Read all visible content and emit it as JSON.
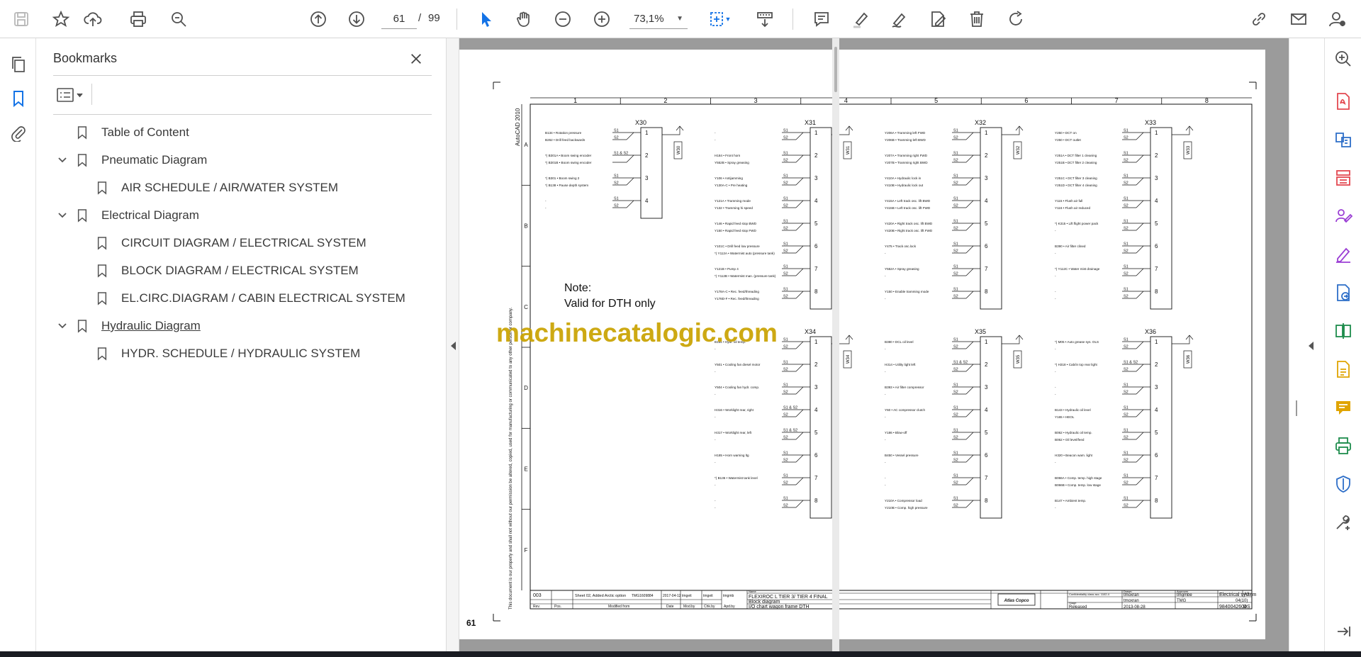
{
  "toolbar": {
    "page_current": "61",
    "page_separator": "/",
    "page_total": "99",
    "zoom_value": "73,1%"
  },
  "bookmarks": {
    "title": "Bookmarks",
    "items": [
      {
        "label": "Table of Content"
      },
      {
        "label": "Pneumatic Diagram"
      },
      {
        "label": "AIR SCHEDULE / AIR/WATER SYSTEM"
      },
      {
        "label": "Electrical Diagram"
      },
      {
        "label": "CIRCUIT DIAGRAM / ELECTRICAL SYSTEM"
      },
      {
        "label": "BLOCK DIAGRAM / ELECTRICAL SYSTEM"
      },
      {
        "label": "EL.CIRC.DIAGRAM / CABIN ELECTRICAL SYSTEM"
      },
      {
        "label": "Hydraulic Diagram"
      },
      {
        "label": "HYDR. SCHEDULE / HYDRAULIC SYSTEM"
      }
    ]
  },
  "document": {
    "page_label": "61",
    "watermark": "machinecatalogic.com",
    "cad_label": "AutoCAD 2010",
    "note_line1": "Note:",
    "note_line2": "Valid for DTH only",
    "col_numbers": [
      "1",
      "2",
      "3",
      "4",
      "5",
      "6",
      "7",
      "8"
    ],
    "row_letters": [
      "A",
      "B",
      "C",
      "D",
      "E",
      "F"
    ],
    "connectors": [
      {
        "name": "X30",
        "pins": [
          "1",
          "2",
          "3",
          "4"
        ],
        "side": "W30",
        "lines": [
          [
            "B134 • Rotation pressure",
            "S1"
          ],
          [
            "B262 • Drill feed backwards",
            "S2"
          ],
          [
            "*) B301A • Boom swing encoder",
            "S1 & S2"
          ],
          [
            "*) B301B • Boom swing encoder",
            ""
          ],
          [
            "*) B301 • Boom swing 2",
            "S1"
          ],
          [
            "*) B138 • Pause depth system",
            "S2"
          ],
          [
            "-",
            "S1"
          ],
          [
            "-",
            "S2"
          ]
        ]
      },
      {
        "name": "X31",
        "pins": [
          "1",
          "2",
          "3",
          "4",
          "5",
          "6",
          "7",
          "8"
        ],
        "side": "W31",
        "lines": [
          [
            "-",
            "S1"
          ],
          [
            "-",
            "S2"
          ],
          [
            "H184 • Front horn",
            "S1"
          ],
          [
            "Y552B • Spray greasing",
            "S2"
          ],
          [
            "Y106 • Antijamming",
            "S1"
          ],
          [
            "Y130A-C • Pre heating",
            "S2"
          ],
          [
            "Y121A • Tramming mode",
            "S1"
          ],
          [
            "Y132 • Tramming hi speed",
            "S2"
          ],
          [
            "Y146 • Rapid feed stop BWD",
            "S1"
          ],
          [
            "Y150 • Rapid feed stop FWD",
            "S2"
          ],
          [
            "Y101C • Drill feed low pressure",
            "S1"
          ],
          [
            "*) Y112A • Watermist auto (pressure tank)",
            "S2"
          ],
          [
            "Y121B • Pump 4",
            "S1"
          ],
          [
            "*) Y112B • Watermist man. (pressure tank)",
            "S2"
          ],
          [
            "Y178A-C • Rec. feed/threading",
            "S1"
          ],
          [
            "Y178D-F • Rec. feed/threading",
            "S2"
          ]
        ]
      },
      {
        "name": "X32",
        "pins": [
          "1",
          "2",
          "3",
          "4",
          "5",
          "6",
          "7",
          "8"
        ],
        "side": "W32",
        "lines": [
          [
            "Y206A • Tramming left FWD",
            "S1"
          ],
          [
            "Y206B • Tramming left BWD",
            "S2"
          ],
          [
            "Y207A • Tramming right FWD",
            "S1"
          ],
          [
            "Y207B • Tramming right BWD",
            "S2"
          ],
          [
            "Y410A • Hydraulic lock in",
            "S1"
          ],
          [
            "Y410B • Hydraulic lock out",
            "S2"
          ],
          [
            "Y415A • Left track osc. lift BWD",
            "S1"
          ],
          [
            "Y415B • Left track osc. lift FWD",
            "S2"
          ],
          [
            "Y420A • Right track osc. lift BWD",
            "S1"
          ],
          [
            "Y420B • Right track osc. lift FWD",
            "S2"
          ],
          [
            "Y475 • Track osc.lock",
            "S1"
          ],
          [
            "-",
            "S2"
          ],
          [
            "Y552A • Spray greasing",
            "S1"
          ],
          [
            "-",
            "S2"
          ],
          [
            "Y150 • Enable tramming mode",
            "S1"
          ],
          [
            "-",
            "S2"
          ]
        ]
      },
      {
        "name": "X33",
        "pins": [
          "1",
          "2",
          "3",
          "4",
          "5",
          "6",
          "7",
          "8"
        ],
        "side": "W33",
        "lines": [
          [
            "Y250 • DCT on",
            "S1"
          ],
          [
            "Y250 • DCT outlet",
            "S2"
          ],
          [
            "Y251A • DCT filter 1 cleaning",
            "S1"
          ],
          [
            "Y251B • DCT filter 2 cleaning",
            "S2"
          ],
          [
            "Y251C • DCT filter 3 cleaning",
            "S1"
          ],
          [
            "Y251D • DCT filter 4 cleaning",
            "S2"
          ],
          [
            "Y115 • Flush air full",
            "S1"
          ],
          [
            "Y116 • Flush air reduced",
            "S2"
          ],
          [
            "*) K315 • Lift flight power pack",
            "S1"
          ],
          [
            "-",
            "S2"
          ],
          [
            "B390 • Air filter clined",
            "S1"
          ],
          [
            "-",
            "S2"
          ],
          [
            "*) Y112C • Water mist drainage",
            "S1"
          ],
          [
            "-",
            "S2"
          ],
          [
            "-",
            "S1"
          ],
          [
            "-",
            "S2"
          ]
        ]
      },
      {
        "name": "X34",
        "pins": [
          "1",
          "2",
          "3",
          "4",
          "5",
          "6",
          "7",
          "8"
        ],
        "side": "W34",
        "lines": [
          [
            "B184 • Hydr. oil temp.",
            "S1"
          ],
          [
            "-",
            "S2"
          ],
          [
            "Y501 • Cooling fan diesel motor",
            "S1"
          ],
          [
            "-",
            "S2"
          ],
          [
            "Y504 • Cooling fan hydr. comp.",
            "S1"
          ],
          [
            "-",
            "S2"
          ],
          [
            "H316 • Worklight rear, right",
            "S1 & S2"
          ],
          [
            "-",
            "S2"
          ],
          [
            "H317 • Worklight rear, left",
            "S1 & S2"
          ],
          [
            "-",
            "S2"
          ],
          [
            "H185 • Horn warning ltg",
            "S1"
          ],
          [
            "-",
            "S2"
          ],
          [
            "*) B136 • Watermist tank level",
            "S1"
          ],
          [
            "-",
            "S2"
          ],
          [
            "-",
            "S1"
          ],
          [
            "-",
            "S2"
          ]
        ]
      },
      {
        "name": "X35",
        "pins": [
          "1",
          "2",
          "3",
          "4",
          "5",
          "6",
          "7",
          "8"
        ],
        "side": "W35",
        "lines": [
          [
            "B380 • DCL oil level",
            "S1"
          ],
          [
            "-",
            "S2"
          ],
          [
            "H314 • Utility light left",
            "S1 & S2"
          ],
          [
            "-",
            "S2"
          ],
          [
            "B393 • Air filter compressor",
            "S1"
          ],
          [
            "-",
            "S2"
          ],
          [
            "Y60 • AC compressor clutch",
            "S1"
          ],
          [
            "-",
            "S2"
          ],
          [
            "Y186 • Blow-off",
            "S1"
          ],
          [
            "-",
            "S2"
          ],
          [
            "B450 • Vessel pressure",
            "S1"
          ],
          [
            "-",
            "S2"
          ],
          [
            "-",
            "S1"
          ],
          [
            "-",
            "S2"
          ],
          [
            "Y210A • Compressor load",
            "S1"
          ],
          [
            "Y210B • Comp. high pressure",
            "S2"
          ]
        ]
      },
      {
        "name": "X36",
        "pins": [
          "1",
          "2",
          "3",
          "4",
          "5",
          "6",
          "7",
          "8"
        ],
        "side": "W36",
        "lines": [
          [
            "*) M05 • Auto grease sys. OLS",
            "S1"
          ],
          [
            "-",
            "S2"
          ],
          [
            "*) H318 • Cab/in top rear light",
            "S1 & S2"
          ],
          [
            "-",
            "S2"
          ],
          [
            "-",
            "S1"
          ],
          [
            "-",
            "S2"
          ],
          [
            "B143 • Hydraulic oil level",
            "S1"
          ],
          [
            "Y165 • HEOL",
            "S2"
          ],
          [
            "B062 • Hydraulic oil temp.",
            "S1"
          ],
          [
            "B062 • Oil level/feed",
            "S2"
          ],
          [
            "H320 • Beacon warn. light",
            "S1"
          ],
          [
            "-",
            "S2"
          ],
          [
            "B066A • Comp. temp. high stage",
            "S1"
          ],
          [
            "B066B • Comp. temp. low stage",
            "S2"
          ],
          [
            "B147 • Ambient temp.",
            "S1"
          ],
          [
            "-",
            "S2"
          ]
        ]
      }
    ],
    "title_block": {
      "rev": "003",
      "rev_text": "Sheet 02, Added Arctic option",
      "rev_ref": "TMG1609884",
      "rev_date": "2017-04-12",
      "rev_mod": "tmgeit",
      "rev_chk": "tmgeit",
      "rev_appd": "tmgmb",
      "h_rev": "Rev.",
      "h_pos": "Pos.",
      "h_modified": "Modified from",
      "h_date": "Date",
      "h_modby": "Mod.by",
      "h_chkby": "Chk.by",
      "h_apdby": "Apd.by",
      "name_label": "Name",
      "name_value": "FLEXIROC L TIER 3/ TIER 4 FINAL",
      "name_value2": "Block diagram",
      "name_value3": "I/O chart wagon frame DTH",
      "drawn_label": "Drawn",
      "drawn_value": "tmoxran",
      "approver_label": "Approver",
      "approver_value": "tmgmbe",
      "checked_value": "tmoxran",
      "resp_value": "TMG",
      "stage_label": "Stage",
      "stage_value": "Released",
      "date_value": "2013-08-28",
      "sheet_code": "Electrical system",
      "sheet_size": "A3",
      "sheet_no": "04(10)",
      "doc_no": "9840042604",
      "doc_lang": "DS",
      "logo": "Atlas Copco",
      "confidential": "Confidentiality class acc. 1102.4",
      "disclaimer": "This document is our property and shall not without our permission be altered, copied, used for manufacturing or communicated to any other person or company."
    }
  },
  "colors": {
    "accent_blue": "#1473e6",
    "icon_gray": "#505050",
    "right_rail_red": "#e34850",
    "right_rail_blue": "#2d6ec8",
    "right_rail_purple": "#9b3fd4",
    "right_rail_green": "#1e8c4c",
    "right_rail_yellow": "#e0a400",
    "watermark_color": "#c9a200"
  }
}
